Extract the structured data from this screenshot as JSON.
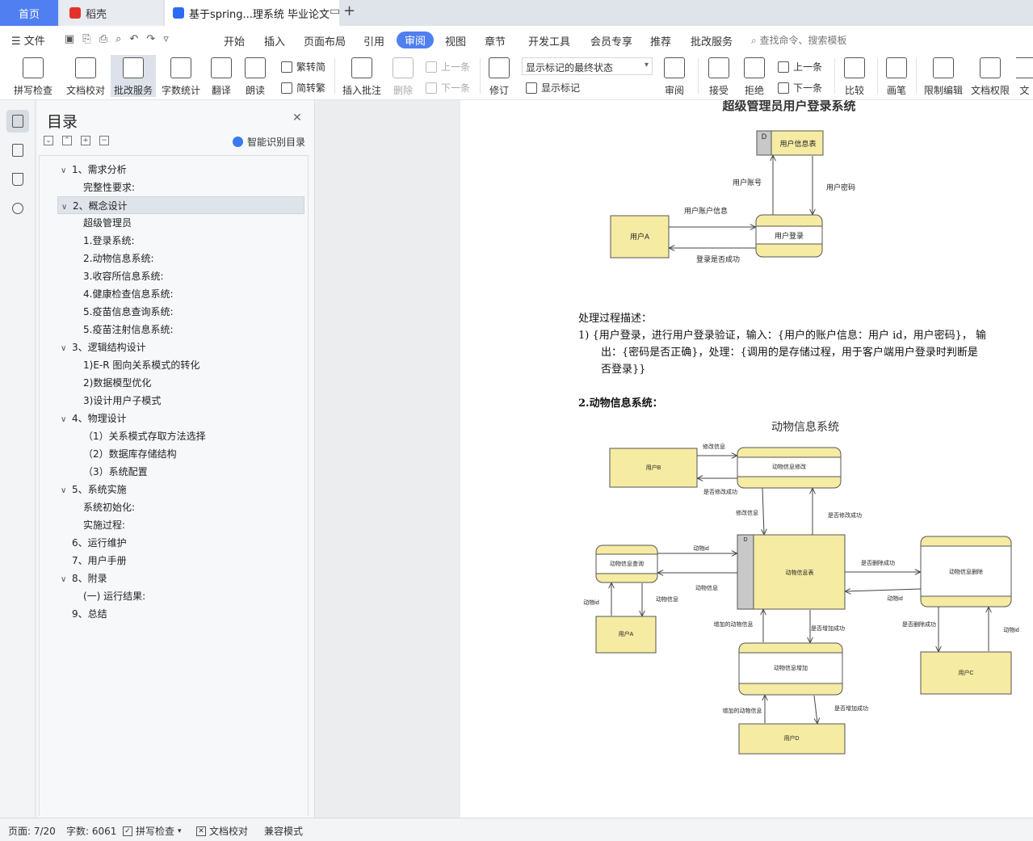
{
  "tabs": {
    "home": "首页",
    "daoke": "稻壳",
    "doc": "基于spring...理系统 毕业论文"
  },
  "menu": {
    "file": "文件",
    "items": [
      "开始",
      "插入",
      "页面布局",
      "引用",
      "审阅",
      "视图",
      "章节",
      "开发工具",
      "会员专享",
      "推荐",
      "批改服务"
    ],
    "active": "审阅",
    "search_placeholder": "查找命令、搜索模板"
  },
  "ribbon": {
    "spell": "拼写检查",
    "doc_check": "文档校对",
    "correct": "批改服务",
    "word_count": "字数统计",
    "translate": "翻译",
    "read": "朗读",
    "trad_to_simp": "繁转简",
    "simp_to_trad": "简转繁",
    "insert_comment": "插入批注",
    "delete": "删除",
    "prev_comment": "上一条",
    "next_comment": "下一条",
    "revise": "修订",
    "markup_state": "显示标记的最终状态",
    "show_markup": "显示标记",
    "review": "审阅",
    "accept": "接受",
    "reject": "拒绝",
    "prev_change": "上一条",
    "next_change": "下一条",
    "compare": "比较",
    "pen": "画笔",
    "restrict": "限制编辑",
    "permission": "文档权限",
    "more": "文"
  },
  "toc": {
    "title": "目录",
    "smart": "智能识别目录",
    "items": [
      {
        "text": "1、需求分析",
        "level": 1,
        "chev": "∨"
      },
      {
        "text": "完整性要求:",
        "level": 2,
        "chev": ""
      },
      {
        "text": "2、概念设计",
        "level": 1,
        "chev": "∨"
      },
      {
        "text": "超级管理员",
        "level": 2,
        "chev": ""
      },
      {
        "text": "1.登录系统:",
        "level": 2,
        "chev": ""
      },
      {
        "text": "2.动物信息系统:",
        "level": 2,
        "chev": ""
      },
      {
        "text": "3.收容所信息系统:",
        "level": 2,
        "chev": ""
      },
      {
        "text": "4.健康检查信息系统:",
        "level": 2,
        "chev": ""
      },
      {
        "text": "5.疫苗信息查询系统:",
        "level": 2,
        "chev": ""
      },
      {
        "text": "5.疫苗注射信息系统:",
        "level": 2,
        "chev": ""
      },
      {
        "text": "3、逻辑结构设计",
        "level": 1,
        "chev": "∨"
      },
      {
        "text": "1)E-R 图向关系模式的转化",
        "level": 2,
        "chev": ""
      },
      {
        "text": "2)数据模型优化",
        "level": 2,
        "chev": ""
      },
      {
        "text": "3)设计用户子模式",
        "level": 2,
        "chev": ""
      },
      {
        "text": "4、物理设计",
        "level": 1,
        "chev": "∨"
      },
      {
        "text": "（1）关系模式存取方法选择",
        "level": 2,
        "chev": ""
      },
      {
        "text": "（2）数据库存储结构",
        "level": 2,
        "chev": ""
      },
      {
        "text": "（3）系统配置",
        "level": 2,
        "chev": ""
      },
      {
        "text": "5、系统实施",
        "level": 1,
        "chev": "∨"
      },
      {
        "text": "系统初始化:",
        "level": 2,
        "chev": ""
      },
      {
        "text": "实施过程:",
        "level": 2,
        "chev": ""
      },
      {
        "text": "6、运行维护",
        "level": 1,
        "chev": ""
      },
      {
        "text": "7、用户手册",
        "level": 1,
        "chev": ""
      },
      {
        "text": "8、附录",
        "level": 1,
        "chev": "∨"
      },
      {
        "text": "(一) 运行结果:",
        "level": 2,
        "chev": ""
      },
      {
        "text": "9、总结",
        "level": 1,
        "chev": ""
      }
    ],
    "selected_index": 2
  },
  "document": {
    "top_title_cut": "超级管理员用户登录系统",
    "login": {
      "store": "用户信息表",
      "store_id": "D",
      "process": "用户登录",
      "entity": "用户A",
      "flow_account": "用户账号",
      "flow_password": "用户密码",
      "flow_info": "用户账户信息",
      "flow_result": "登录是否成功"
    },
    "process_desc_title": "处理过程描述：",
    "process_desc_line1": "1) {用户登录，进行用户登录验证，输入：{用户的账户信息：用户 id，用户密码}， 输",
    "process_desc_line2": "出：{密码是否正确}，处理：{调用的是存储过程，用于客户端用户登录时判断是",
    "process_desc_line3": "否登录}}",
    "section2": "2.动物信息系统：",
    "animal": {
      "title": "动物信息系统",
      "store": "动物信息表",
      "store_id": "D",
      "p_modify": "动物信息修改",
      "p_query": "动物信息查询",
      "p_delete": "动物信息删除",
      "p_add": "动物信息增加",
      "e_b": "用户B",
      "e_a": "用户A",
      "e_c": "用户C",
      "e_d": "用户D",
      "f_modify_info": "修改信息",
      "f_modify_ok": "是否修改成功",
      "f_modify_info2": "修改信息",
      "f_modify_ok2": "是否修改成功",
      "f_animal_id": "动物id",
      "f_animal_info": "动物信息",
      "f_animal_id_a": "动物id",
      "f_animal_info_a": "动物信息",
      "f_delete_ok": "是否删除成功",
      "f_animal_id_del": "动物id",
      "f_delete_ok_c": "是否删除成功",
      "f_animal_id_c": "动物id",
      "f_added_info": "增加的动物信息",
      "f_add_ok": "是否增加成功",
      "f_added_info_d": "增加的动物信息",
      "f_add_ok_d": "是否增加成功"
    }
  },
  "status": {
    "page": "页面: 7/20",
    "words": "字数: 6061",
    "spell": "拼写检查",
    "doc_check": "文档校对",
    "compat": "兼容模式"
  },
  "colors": {
    "accent": "#4f7ff0",
    "box_fill": "#f5eba3",
    "box_stroke": "#555555"
  }
}
